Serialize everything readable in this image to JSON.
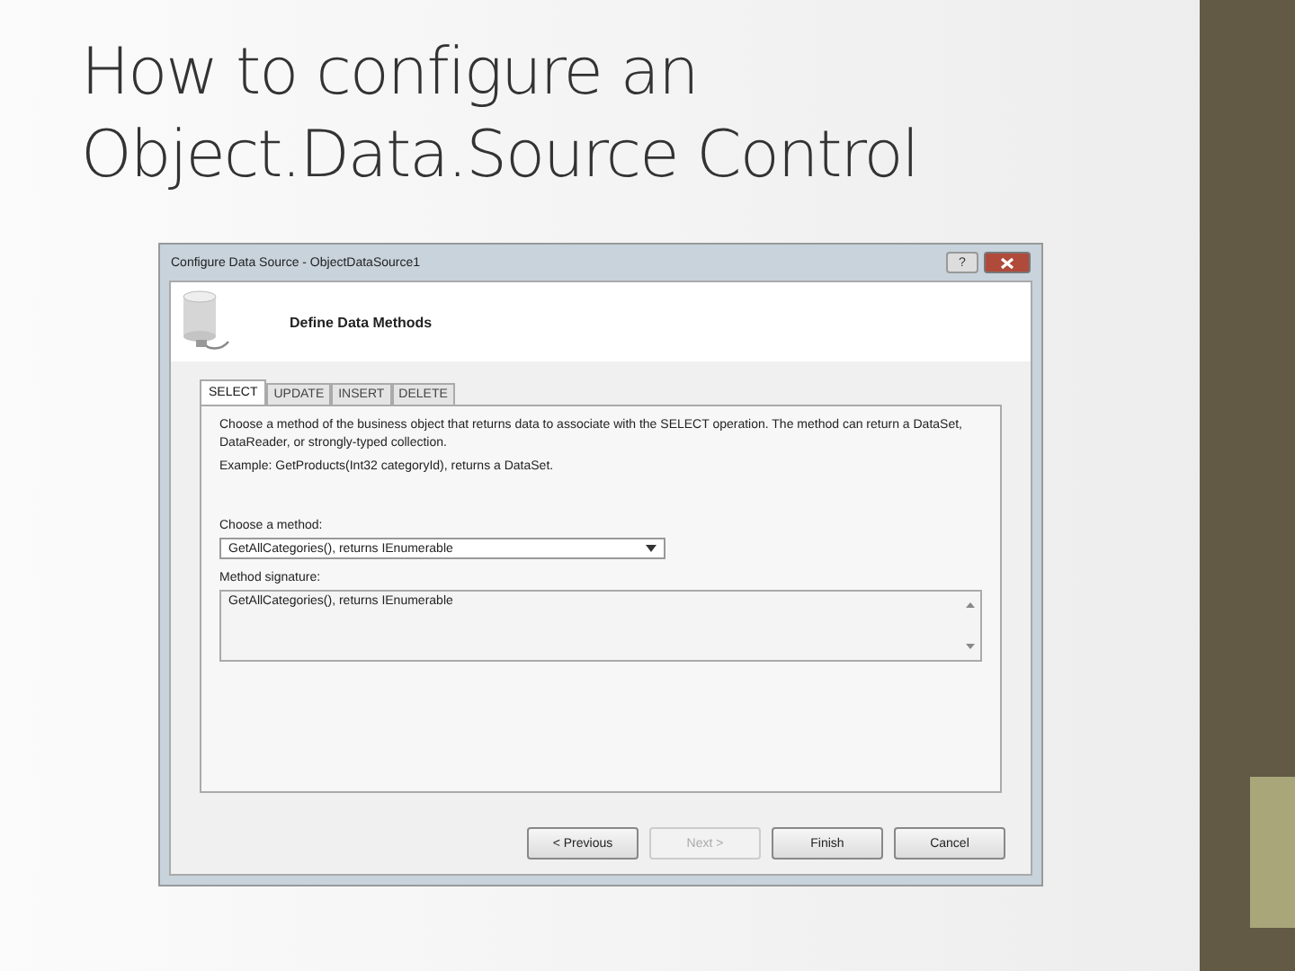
{
  "slide": {
    "title_lines": [
      "How to configure an",
      "Object.Data.Source Control"
    ]
  },
  "dialog": {
    "title": "Configure Data Source - ObjectDataSource1",
    "help_button": "?",
    "header": "Define Data Methods",
    "tabs": [
      {
        "label": "SELECT",
        "selected": true
      },
      {
        "label": "UPDATE",
        "selected": false
      },
      {
        "label": "INSERT",
        "selected": false
      },
      {
        "label": "DELETE",
        "selected": false
      }
    ],
    "description": "Choose a method of the business object that returns data to associate with the SELECT operation. The method can return a DataSet, DataReader, or strongly-typed collection.",
    "example": "Example: GetProducts(Int32 categoryId), returns a DataSet.",
    "method_label": "Choose a method:",
    "method_value": "GetAllCategories(), returns IEnumerable",
    "signature_label": "Method signature:",
    "signature_value": "GetAllCategories(), returns IEnumerable",
    "buttons": [
      {
        "label": "< Previous",
        "disabled": false
      },
      {
        "label": "Next >",
        "disabled": true
      },
      {
        "label": "Finish",
        "disabled": false
      },
      {
        "label": "Cancel",
        "disabled": false
      }
    ]
  }
}
